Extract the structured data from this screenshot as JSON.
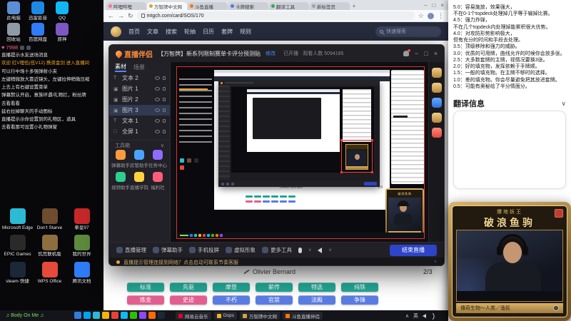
{
  "desktop": {
    "icons_top": [
      {
        "label": "此电脑",
        "color": "#5a8fd6",
        "icon": "computer-icon"
      },
      {
        "label": "迅雷影音",
        "color": "#1e88e5",
        "icon": "media-player-icon"
      },
      {
        "label": "QQ",
        "color": "#12b7f5",
        "icon": "qq-icon"
      },
      {
        "label": "回收站",
        "color": "#8e9aa6",
        "icon": "recycle-bin-icon"
      },
      {
        "label": "百度网盘",
        "color": "#2f7cf6",
        "icon": "netdisk-icon"
      },
      {
        "label": "原神",
        "color": "#7e57c2",
        "icon": "game-icon"
      }
    ],
    "icons_bottom": [
      {
        "label": "Microsoft Edge",
        "color": "#2bbcd4",
        "icon": "edge-icon"
      },
      {
        "label": "Don't Starve",
        "color": "#6d4c2f",
        "icon": "dont-starve-icon"
      },
      {
        "label": "拳皇97",
        "color": "#c62828",
        "icon": "kof-icon"
      },
      {
        "label": "EPIC Games",
        "color": "#2a2a2a",
        "icon": "epic-icon"
      },
      {
        "label": "饥荒联机版",
        "color": "#8d6e3f",
        "icon": "dst-icon"
      },
      {
        "label": "我的世界",
        "color": "#5d8a3c",
        "icon": "minecraft-icon"
      },
      {
        "label": "steam·快捷",
        "color": "#1b2838",
        "icon": "steam-icon"
      },
      {
        "label": "WPS Office",
        "color": "#e64a3b",
        "icon": "wps-icon"
      },
      {
        "label": "腾讯文档",
        "color": "#2f7cf6",
        "icon": "docs-icon"
      }
    ],
    "lyrics": "♫ Body On Me ♫"
  },
  "chat_overlay": {
    "viewer_count": "♥ 7998",
    "messages": [
      {
        "text": "直播提示水友送场消息",
        "color": "#e8e8e8"
      },
      {
        "text": "欢迎 红V理伍(伍V12) 携资金剑 进入直播间",
        "color": "#f5a623"
      },
      {
        "text": "可以行中场十多强弹射小夹",
        "color": "#e8e8e8"
      },
      {
        "text": "左键稍微放大靠近镜头，左键拉伸稍微压缩",
        "color": "#e8e8e8"
      },
      {
        "text": "上去上有右键设置菜单",
        "color": "#e8e8e8"
      },
      {
        "text": "弹幕默认开启，意族环遇/礼物拦，粉丝牌",
        "color": "#e8e8e8"
      },
      {
        "text": "去看看看",
        "color": "#e8e8e8"
      },
      {
        "text": "延右拉掉聊天的手动图标",
        "color": "#e8e8e8"
      },
      {
        "text": "直播提示示你设置到的礼物区，道具",
        "color": "#e8e8e8"
      },
      {
        "text": "去看看那可设置小礼物弹窗",
        "color": "#e8e8e8"
      }
    ]
  },
  "browser": {
    "tabs": [
      {
        "label": "哔哩哔哩",
        "color": "#fb7299"
      },
      {
        "label": "万智牌中文网",
        "color": "#d4a43c",
        "cls": "active"
      },
      {
        "label": "斗鱼直播",
        "color": "#ff7500"
      },
      {
        "label": "卡牌搜索",
        "color": "#4a7de0"
      },
      {
        "label": "翻译工具",
        "color": "#34a853"
      },
      {
        "label": "新标签页",
        "color": "#9aa0a6"
      }
    ],
    "url": "mtgch.com/card/SOS/170",
    "nav": [
      "首页",
      "文章",
      "搜索",
      "轮抽",
      "日历",
      "套牌",
      "规则"
    ],
    "search_placeholder": "快速搜索",
    "page": {
      "artist": "Olivier Bernard",
      "pager": "2/3",
      "formats_row1": [
        {
          "label": "标准",
          "bg": "#23a795"
        },
        {
          "label": "先驱",
          "bg": "#23a795"
        },
        {
          "label": "摩登",
          "bg": "#23a795"
        },
        {
          "label": "薪传",
          "bg": "#23a795"
        },
        {
          "label": "特选",
          "bg": "#23a795"
        },
        {
          "label": "纯铁",
          "bg": "#23a795"
        }
      ],
      "formats_row2": [
        {
          "label": "炼金",
          "bg": "#e2608f"
        },
        {
          "label": "史迹",
          "bg": "#e2608f"
        },
        {
          "label": "不朽",
          "bg": "#5b7ce2"
        },
        {
          "label": "官禁",
          "bg": "#5b7ce2"
        },
        {
          "label": "法殿",
          "bg": "#5b7ce2"
        },
        {
          "label": "争锋",
          "bg": "#5b7ce2"
        }
      ]
    }
  },
  "app": {
    "title": "直播伴侣",
    "stream_title": "【万智牌】新系列限制赛单卡评分预测贴",
    "edit_label": "修改",
    "meta": "已开播 · 观看人数 5094185",
    "panel_tabs": [
      {
        "label": "素材",
        "cls": "selected"
      },
      {
        "label": "场景"
      }
    ],
    "layers": [
      {
        "type": "T",
        "label": "文本 2"
      },
      {
        "type": "▣",
        "label": "图片 1"
      },
      {
        "type": "▣",
        "label": "图片 2"
      },
      {
        "type": "▣",
        "label": "图片 3",
        "cls": "selected"
      },
      {
        "type": "T",
        "label": "文本 1"
      },
      {
        "type": "□",
        "label": "全屏 1"
      }
    ],
    "toolbox_label": "工具箱",
    "toolbox_caret": "∨",
    "tools": [
      {
        "label": "弹幕助手",
        "color": "#ff9b3d"
      },
      {
        "label": "房管助手",
        "color": "#4aa3ff"
      },
      {
        "label": "任务中心",
        "color": "#8f6bff"
      },
      {
        "label": "视频助手",
        "color": "#2ecf8e"
      },
      {
        "label": "直播学院",
        "color": "#ffd23d"
      },
      {
        "label": "福利社",
        "color": "#ff5d7a"
      }
    ],
    "toolbar": [
      "直播管理",
      "弹幕助手",
      "手机投屏",
      "虚拟形象",
      "更多工具"
    ],
    "end_button": "结束直播",
    "banner": "直播提示管理连接到网络？点击启动可联系节奏客服",
    "preview": {
      "artist": "Olivier Bernard",
      "pager": "2/3"
    }
  },
  "right_panel": {
    "rating_guide": [
      "5.0：容易施放，效果强大，",
      "不在0-1个topdeck处理掉几乎等于输掉比赛。",
      "4.5：强力炸弹，",
      "不在几个topdeck内处理掉能累积很大优势。",
      "4.0：对攻防形势影响极大，",
      "但有充分的时间和手段去处理。",
      "3.5：顶级移除和强力的威胁。",
      "3.0：优质的可用牌，曲线允许的时候你会放多张。",
      "2.5：大多数套牌的主牌，视情况要换3张。",
      "2.0：好的填充物，发挥依赖于手牌顺。",
      "1.5：一般的填充物。在主牌不够时的选择。",
      "1.0：差的填充物。你会尽量避免把其放进套牌。",
      "0.5：可能有奥秘给了半分情面分。"
    ],
    "translation_header": "翻译信息",
    "chevron": "∨"
  },
  "streamer_card": {
    "badge": "爆地妖王",
    "name": "破浪鱼驹",
    "typeline": "傳奇生物～人类／渔民"
  },
  "taskbar": {
    "icons": [
      "#2f7de1",
      "#00a4ef",
      "#2bbcd4",
      "#f4b400",
      "#ea4335",
      "#12b7f5",
      "#2dc100",
      "#9146ff",
      "#ff6a00",
      "#1b2838"
    ],
    "buttons": [
      {
        "label": "网易云音乐",
        "color": "#e60026"
      },
      {
        "label": "Oops",
        "color": "#f2b01e"
      },
      {
        "label": "万智牌中文网",
        "color": "#d4a43c"
      },
      {
        "label": "斗鱼直播伴侣",
        "color": "#ff7500"
      }
    ],
    "tray": [
      "∧",
      "英"
    ]
  }
}
